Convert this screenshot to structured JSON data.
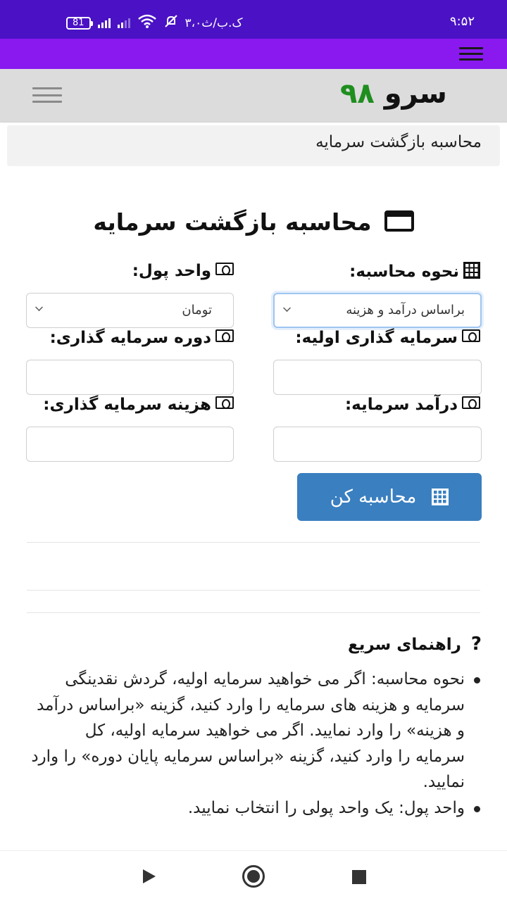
{
  "status_bar": {
    "time": "۹:۵۲",
    "speed": "۳،۰ک.ب/ث",
    "battery": "81"
  },
  "header": {
    "logo_word": "سرو",
    "logo_number": "۹۸"
  },
  "breadcrumb": "محاسبه بازگشت سرمایه",
  "page_title": "محاسبه بازگشت سرمایه",
  "form": {
    "calc_method_label": "نحوه محاسبه:",
    "calc_method_value": "براساس درآمد و هزینه",
    "currency_label": "واحد پول:",
    "currency_value": "تومان",
    "initial_investment_label": "سرمایه گذاری اولیه:",
    "investment_period_label": "دوره سرمایه گذاری:",
    "capital_income_label": "درآمد سرمایه:",
    "investment_cost_label": "هزینه سرمایه گذاری:",
    "submit_label": "محاسبه کن"
  },
  "guide": {
    "title": "راهنمای سریع",
    "icon": "?",
    "items": [
      "نحوه محاسبه: اگر می خواهید سرمایه اولیه، گردش نقدینگی سرمایه و هزینه های سرمایه را وارد کنید، گزینه «براساس درآمد و هزینه» را وارد نمایید. اگر می خواهید سرمایه اولیه، کل سرمایه را وارد کنید، گزینه «براساس سرمایه پایان دوره» را وارد نمایید.",
      "واحد پول: یک واحد پولی را انتخاب نمایید."
    ]
  }
}
